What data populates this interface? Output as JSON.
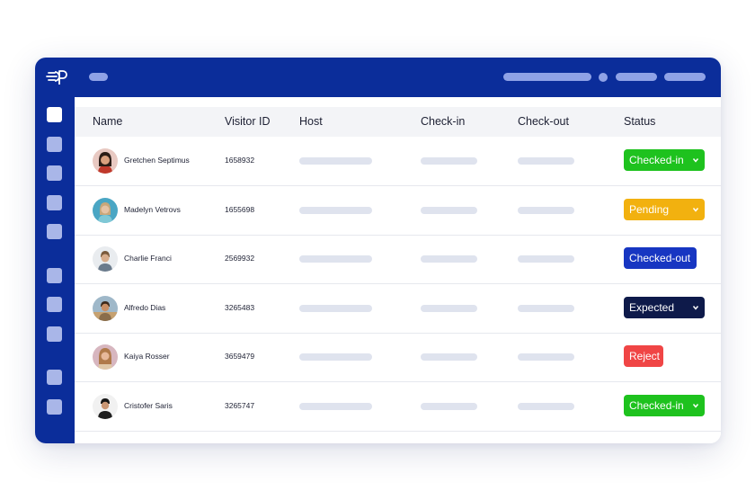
{
  "app": {
    "logo_icon": "brand-logo-icon",
    "accent_color": "#0b2d9a"
  },
  "table": {
    "columns": [
      "Name",
      "Visitor ID",
      "Host",
      "Check-in",
      "Check-out",
      "Status"
    ],
    "rows": [
      {
        "name": "Gretchen Septimus",
        "visitor_id": "1658932",
        "status": "Checked-in",
        "status_color": "#1ec21e",
        "dropdown": true
      },
      {
        "name": "Madelyn Vetrovs",
        "visitor_id": "1655698",
        "status": "Pending",
        "status_color": "#f2b10f",
        "dropdown": true
      },
      {
        "name": "Charlie Franci",
        "visitor_id": "2569932",
        "status": "Checked-out",
        "status_color": "#1736c2",
        "dropdown": false
      },
      {
        "name": "Alfredo Dias",
        "visitor_id": "3265483",
        "status": "Expected",
        "status_color": "#0e1a4a",
        "dropdown": true
      },
      {
        "name": "Kaiya Rosser",
        "visitor_id": "3659479",
        "status": "Reject",
        "status_color": "#f04545",
        "dropdown": false
      },
      {
        "name": "Cristofer Saris",
        "visitor_id": "3265747",
        "status": "Checked-in",
        "status_color": "#1ec21e",
        "dropdown": true
      }
    ]
  }
}
